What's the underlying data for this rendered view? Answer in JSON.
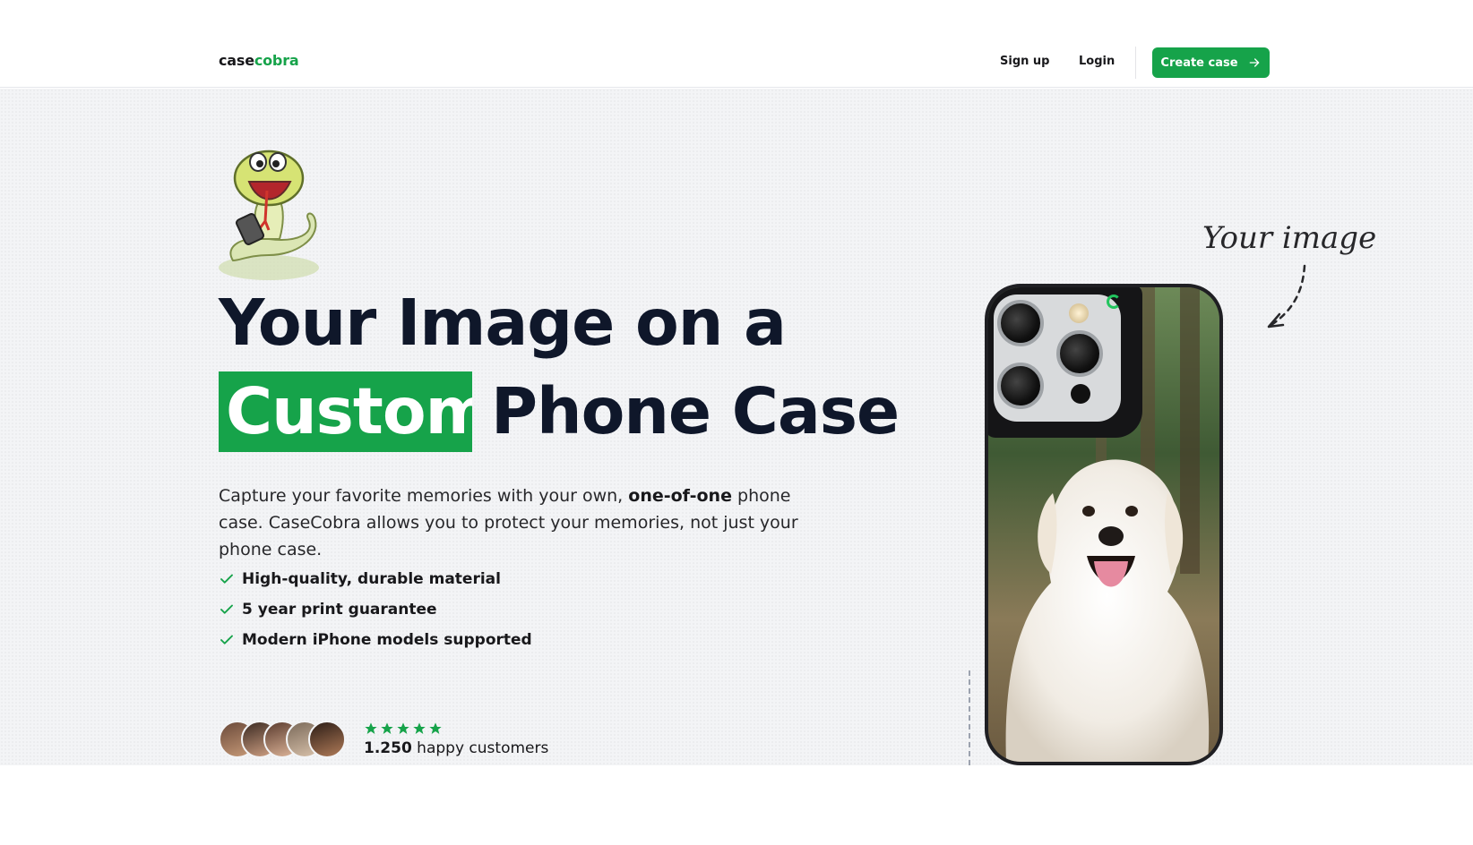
{
  "nav": {
    "logo_part1": "case",
    "logo_part2": "cobra",
    "signup": "Sign up",
    "login": "Login",
    "create": "Create case"
  },
  "hero": {
    "headline_line1": "Your Image on a",
    "headline_highlight": "Custom",
    "headline_line2": "Phone Case",
    "lead_a": "Capture your favorite memories with your own, ",
    "lead_bold": "one-of-one",
    "lead_b": " phone case. CaseCobra allows you to protect your memories, not just your phone case.",
    "features": [
      "High-quality, durable material",
      "5 year print guarantee",
      "Modern iPhone models supported"
    ],
    "rating_stars": 5,
    "customers_count": "1.250",
    "customers_label": " happy customers",
    "annotation": "Your image"
  },
  "colors": {
    "accent": "#16a34a",
    "heading": "#0f172a"
  },
  "icons": {
    "check": "check-icon",
    "arrow": "arrow-right-icon",
    "star": "star-icon"
  }
}
